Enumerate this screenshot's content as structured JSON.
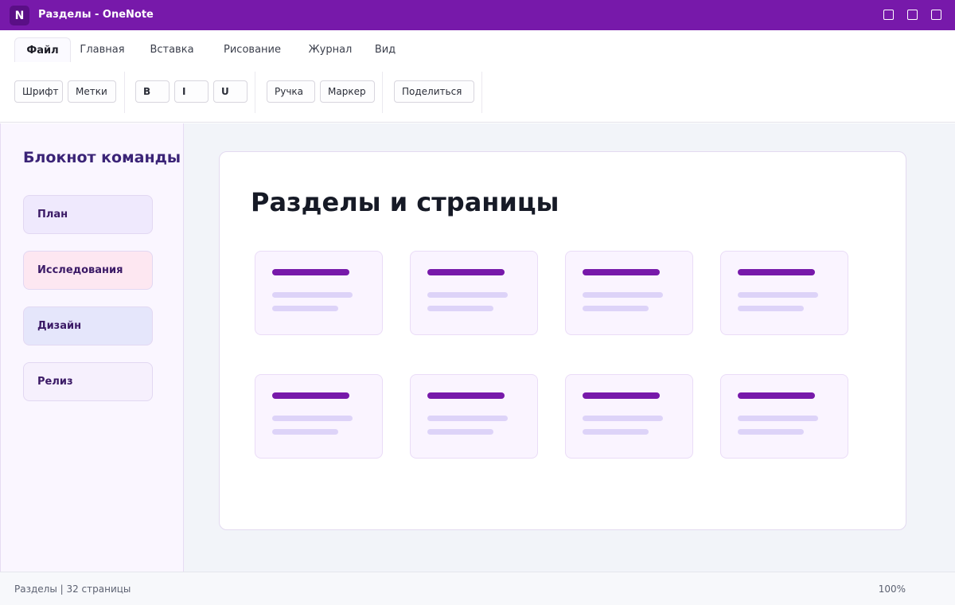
{
  "app": {
    "icon_letter": "N",
    "title": "Разделы - OneNote",
    "brand_color": "#7719aa"
  },
  "window_controls": [
    "minimize",
    "maximize",
    "close"
  ],
  "ribbon": {
    "tabs": [
      {
        "label": "Файл",
        "active": true
      },
      {
        "label": "Главная",
        "active": false
      },
      {
        "label": "Вставка",
        "active": false
      },
      {
        "label": "Рисование",
        "active": false
      },
      {
        "label": "Журнал",
        "active": false
      },
      {
        "label": "Вид",
        "active": false
      }
    ],
    "commands": {
      "font": "Шрифт",
      "tags": "Метки",
      "bold": "B",
      "italic": "I",
      "underline": "U",
      "pen": "Ручка",
      "marker": "Маркер",
      "share": "Поделиться"
    }
  },
  "sidebar": {
    "notebook_title": "Блокнот команды",
    "sections": [
      {
        "label": "План",
        "color": "#efe9fd"
      },
      {
        "label": "Исследования",
        "color": "#fde7f1"
      },
      {
        "label": "Дизайн",
        "color": "#e5e6fb"
      },
      {
        "label": "Релиз",
        "color": "#f6f0fd"
      }
    ]
  },
  "main": {
    "heading": "Разделы и страницы",
    "page_cards_count": 8
  },
  "status": {
    "left": "Разделы | 32 страницы",
    "zoom": "100%"
  }
}
